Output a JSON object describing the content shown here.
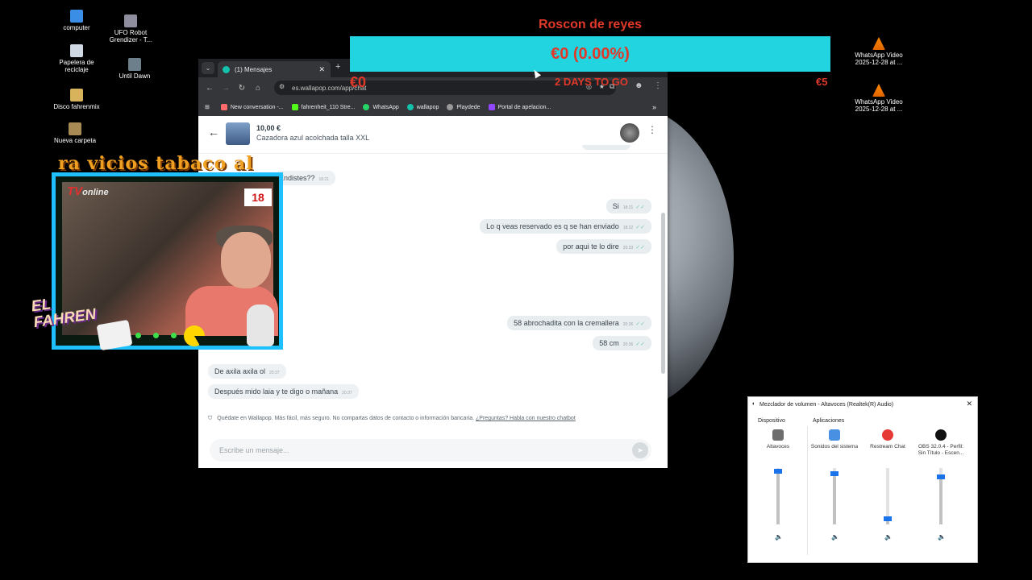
{
  "desktop": {
    "icons": [
      {
        "label": "computer",
        "name": "computer-icon"
      },
      {
        "label": "Papelera de reciclaje",
        "name": "recycle-bin-icon"
      },
      {
        "label": "Disco fahrenmix",
        "name": "disk-icon"
      },
      {
        "label": "Nueva carpeta",
        "name": "folder-icon"
      },
      {
        "label": "UFO Robot Grendizer - T...",
        "name": "game-icon"
      },
      {
        "label": "Until Dawn",
        "name": "game-icon"
      },
      {
        "label": "WhatsApp Video 2025-12-28 at ...",
        "name": "vlc-icon"
      },
      {
        "label": "WhatsApp Video 2025-12-28 at ...",
        "name": "vlc-icon"
      }
    ]
  },
  "goal": {
    "title": "Roscon de reyes",
    "amount": "€0 (0.00%)",
    "progress_fraction": 0.0,
    "start": "€0",
    "remaining": "2 DAYS TO GO",
    "target": "€5",
    "bar_color": "#22d3e0",
    "text_color": "#e0392a"
  },
  "browser": {
    "tab_title": "(1) Mensajes",
    "url": "es.wallapop.com/app/chat",
    "bookmarks": [
      "New conversation -...",
      "fahrenheit_110 Stre...",
      "WhatsApp",
      "wallapop",
      "Playdede",
      "Portal de apelacion..."
    ],
    "overflow": "»"
  },
  "chat": {
    "price": "10,00 €",
    "product": "Cazadora azul acolchada talla XXL",
    "messages": [
      {
        "text": "Endistes??",
        "time": "18:21",
        "dir": "in"
      },
      {
        "text": "Si",
        "time": "18:21",
        "dir": "out"
      },
      {
        "text": "Lo q veas reservado es q se han enviado",
        "time": "18:22",
        "dir": "out"
      },
      {
        "text": "por aqui te lo dire",
        "time": "20:33",
        "dir": "out"
      },
      {
        "text": "58 abrochadita con la cremallera",
        "time": "20:36",
        "dir": "out"
      },
      {
        "text": "58 cm",
        "time": "20:36",
        "dir": "out"
      },
      {
        "text": "De axila axila ol",
        "time": "20:37",
        "dir": "in"
      },
      {
        "text": "Después mido laia y te digo o mañana",
        "time": "20:37",
        "dir": "in"
      }
    ],
    "notice": "Quédate en Wallapop. Más fácil, más seguro. No compartas datos de contacto o información bancaria.",
    "notice_link": "¿Preguntas? Habla con nuestro chatbot",
    "composer_placeholder": "Escribe un mensaje..."
  },
  "overlay": {
    "marquee": "ra vicios tabaco al",
    "tv": "TV",
    "tv_sub": "online",
    "age": "18",
    "brand_line1": "EL",
    "brand_line2": "FAHREN"
  },
  "mixer": {
    "title": "Mezclador de volumen - Altavoces (Realtek(R) Audio)",
    "device_header": "Dispositivo",
    "apps_header": "Aplicaciones",
    "channels": [
      {
        "label": "Altavoces",
        "level": 0.95
      },
      {
        "label": "Sonidos del sistema",
        "level": 0.9
      },
      {
        "label": "Restream Chat",
        "level": 0.1
      },
      {
        "label": "OBS 32.0.4 - Perfil: Sin Título - Escen...",
        "level": 0.85
      }
    ]
  }
}
